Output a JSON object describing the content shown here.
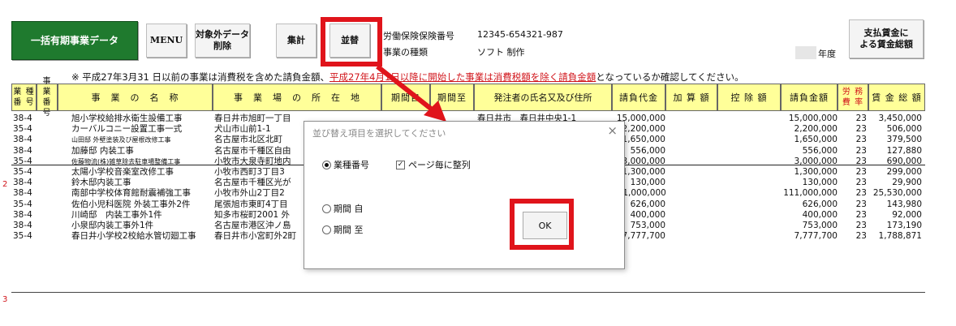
{
  "toolbar": {
    "bulk_button": "一括有期事業データ",
    "menu_button": "MENU",
    "excluded_button_line1": "対象外データ",
    "excluded_button_line2": "削除",
    "total_button": "集計",
    "sort_button": "並替",
    "wages_button_line1": "支払賃金に",
    "wages_button_line2": "よる賃金総額"
  },
  "info": {
    "insurance_label": "労働保険保険番号",
    "insurance_value": "12345-654321-987",
    "business_label": "事業の種類",
    "business_value": "ソフト 制作",
    "year_label": "年度"
  },
  "notice": {
    "prefix": "※ 平成27年3月31 日以前の事業は消費税を含めた請負金額、",
    "link": "平成27年4月1日以降に開始した事業は消費税額を除く請負金額",
    "suffix": "となっているか確認してください。"
  },
  "table": {
    "headers": {
      "code1": "業 種\n番 号",
      "code2": "事 業\n番 号",
      "name": "事　業　の　名　称",
      "location": "事　業　場　の　所　在　地",
      "from": "期間自",
      "to": "期間至",
      "client": "発注者の氏名又及び住所",
      "contract": "請負代金",
      "add": "加 算 額",
      "deduct": "控 除 額",
      "amount": "請負金額",
      "rate": "労 務\n費 率",
      "wages": "賃 金 総 額"
    },
    "rows": [
      {
        "code": "38-4",
        "name": "旭小学校給排水衛生設備工事",
        "loc": "春日井市旭町一丁目",
        "client": "春日井市　春日井中央1-1",
        "contract": "15,000,000",
        "amount": "15,000,000",
        "rate": "23",
        "wages": "3,450,000"
      },
      {
        "code": "35-4",
        "name": "カーバルコニー設置工事一式",
        "loc": "犬山市山前1-1",
        "client": "",
        "contract": "2,200,000",
        "amount": "2,200,000",
        "rate": "23",
        "wages": "506,000"
      },
      {
        "code": "38-4",
        "name": "山田邸 外壁塗装及び屋根改修工事",
        "loc": "名古屋市北区北町",
        "client": "",
        "contract": "1,650,000",
        "amount": "1,650,000",
        "rate": "23",
        "wages": "379,500"
      },
      {
        "code": "38-4",
        "name": "加藤邸 内装工事",
        "loc": "名古屋市千種区自由",
        "client": "",
        "contract": "556,000",
        "amount": "556,000",
        "rate": "23",
        "wages": "127,880"
      },
      {
        "code": "35-4",
        "name": "佐藤物流(株)雑草除去駐車場整備工事",
        "loc": "小牧市大泉寺町地内",
        "client": "",
        "contract": "3,000,000",
        "amount": "3,000,000",
        "rate": "23",
        "wages": "690,000"
      },
      {
        "code": "35-4",
        "name": "太陽小学校音楽室改修工事",
        "loc": "小牧市西町3丁目3",
        "client": "",
        "contract": "1,300,000",
        "amount": "1,300,000",
        "rate": "23",
        "wages": "299,000"
      },
      {
        "code": "38-4",
        "name": "鈴木邸内装工事",
        "loc": "名古屋市千種区光が",
        "client": "",
        "contract": "130,000",
        "amount": "130,000",
        "rate": "23",
        "wages": "29,900"
      },
      {
        "code": "38-4",
        "name": "南部中学校体育館耐震補強工事",
        "loc": "小牧市外山2丁目2",
        "client": "",
        "contract": "111,000,000",
        "amount": "111,000,000",
        "rate": "23",
        "wages": "25,530,000"
      },
      {
        "code": "35-4",
        "name": "佐伯小児科医院 外装工事外2件",
        "loc": "尾張旭市東町4丁目",
        "client": "",
        "contract": "626,000",
        "amount": "626,000",
        "rate": "23",
        "wages": "143,980"
      },
      {
        "code": "38-4",
        "name": "川崎邸　内装工事外1件",
        "loc": "知多市桜町2001 外",
        "client": "",
        "contract": "400,000",
        "amount": "400,000",
        "rate": "23",
        "wages": "92,000"
      },
      {
        "code": "38-4",
        "name": "小泉邸内装工事外1件",
        "loc": "名古屋市港区沖ノ島",
        "client": "",
        "contract": "753,000",
        "amount": "753,000",
        "rate": "23",
        "wages": "173,190"
      },
      {
        "code": "35-4",
        "name": "春日井小学校2校給水管切廻工事",
        "loc": "春日井市小宮町外2町",
        "client": "春日井市　春日井中央1-1",
        "contract": "7,777,700",
        "amount": "7,777,700",
        "rate": "23",
        "wages": "1,788,871"
      }
    ]
  },
  "dialog": {
    "title": "並び替え項目を選択してください",
    "close": "×",
    "option_code": "業種番号",
    "option_page": "ページ毎に整列",
    "option_from": "期間 自",
    "option_to": "期間 至",
    "ok": "OK"
  },
  "colors": {
    "highlight": "#e0141b",
    "header": "#ffff99",
    "button_green": "#1f7a2e"
  },
  "margin_mark_1": "2",
  "margin_mark_2": "3"
}
